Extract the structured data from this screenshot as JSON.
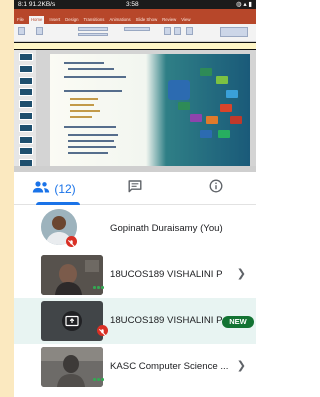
{
  "status_bar": {
    "left": "8:1 91.2KB/s",
    "time": "3:58"
  },
  "ppt": {
    "tabs": [
      "File",
      "Home",
      "Insert",
      "Design",
      "Transitions",
      "Animations",
      "Slide Show",
      "Review",
      "View"
    ],
    "active_tab": "Home",
    "colors": {
      "brand": "#b7472a"
    }
  },
  "meet_tabs": {
    "people_count": "(12)",
    "colors": {
      "accent": "#1a73e8",
      "active_row": "#e8f4f2",
      "new_badge": "#137333",
      "muted": "#d93025"
    }
  },
  "participants": [
    {
      "name": "Gopinath Duraisamy (You)",
      "has_chevron": false,
      "muted": true
    },
    {
      "name": "18UCOS189 VISHALINI P",
      "has_chevron": true
    },
    {
      "name": "18UCOS189 VISHALINI P",
      "badge": "NEW",
      "presenting": true,
      "muted": true
    },
    {
      "name": "KASC Computer Science ...",
      "has_chevron": true
    }
  ],
  "icons": {
    "people_tab": "people-icon",
    "chat_tab": "chat-icon",
    "info_tab": "info-icon",
    "present": "present-screen-icon",
    "mic_off": "mic-off-icon",
    "chevron": "chevron-right-icon"
  }
}
